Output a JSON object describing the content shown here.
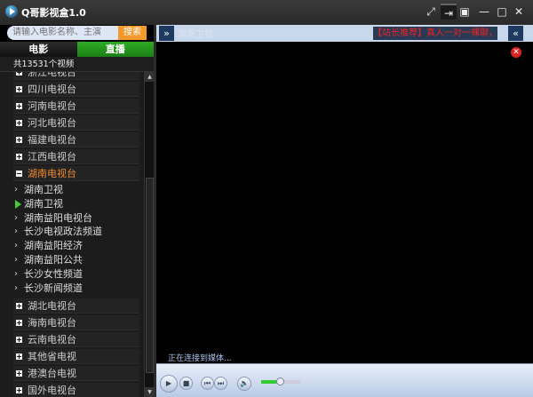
{
  "app": {
    "title": "Q哥影视盒1.0"
  },
  "window_controls": [
    "expand-icon",
    "pin-icon",
    "mini-mode-icon",
    "minimize-icon",
    "maximize-icon",
    "close-icon"
  ],
  "search": {
    "placeholder": "请输入电影名称、主演",
    "button": "搜索"
  },
  "tabs": [
    {
      "label": "电影",
      "active": false
    },
    {
      "label": "直播",
      "active": true
    }
  ],
  "count_text": "共13531个视频",
  "list": {
    "groups_before": [
      "浙江电视台",
      "四川电视台",
      "河南电视台",
      "河北电视台",
      "福建电视台",
      "江西电视台"
    ],
    "open_group": {
      "label": "湖南电视台",
      "children": [
        "湖南卫视",
        "湖南卫视",
        "湖南益阳电视台",
        "长沙电视政法频道",
        "湖南益阳经济",
        "湖南益阳公共",
        "长沙女性频道",
        "长沙新闻频道"
      ],
      "playing_index": 1
    },
    "groups_after": [
      "湖北电视台",
      "海南电视台",
      "云南电视台",
      "其他省电视",
      "港澳台电视",
      "国外电视台"
    ]
  },
  "player": {
    "now_playing": "湖南卫视",
    "ad_text": "【站长推荐】真人一对一裸聊，想",
    "status": "正在连接到媒体...",
    "volume_percent": 45
  },
  "colors": {
    "accent_green": "#2eaa24",
    "search_orange": "#f39a2b",
    "open_group": "#f08a2a",
    "ad_red": "#e22222"
  }
}
